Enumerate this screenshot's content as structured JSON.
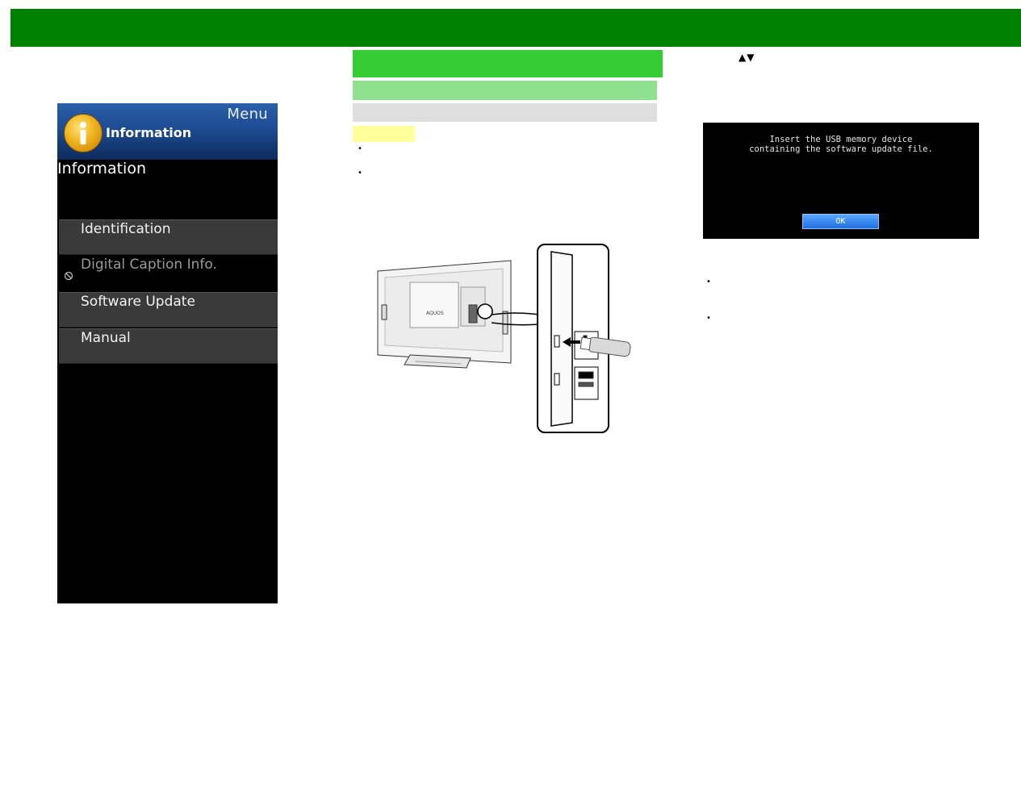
{
  "menu": {
    "header_label": "Menu",
    "title": "Information",
    "section_title": "Information",
    "items": [
      {
        "label": "Identification",
        "enabled": true
      },
      {
        "label": "Digital Caption Info.",
        "enabled": false
      },
      {
        "label": "Software Update",
        "enabled": true
      },
      {
        "label": "Manual",
        "enabled": true
      }
    ]
  },
  "illustration": {
    "tv_brand": "AQUOS"
  },
  "right": {
    "arrow_keys": "▲▼"
  },
  "dialog": {
    "message": "Insert the USB memory device\ncontaining the software update file.",
    "ok_label": "OK"
  },
  "colors": {
    "header_green": "#008000",
    "bar_green": "#33cc33",
    "bar_light_green": "#8fe08f",
    "bar_grey": "#dedede",
    "note_yellow": "#ffff99"
  },
  "icons": {
    "menu_icon": "information-icon",
    "disabled_item_icon": "prohibited-icon"
  }
}
